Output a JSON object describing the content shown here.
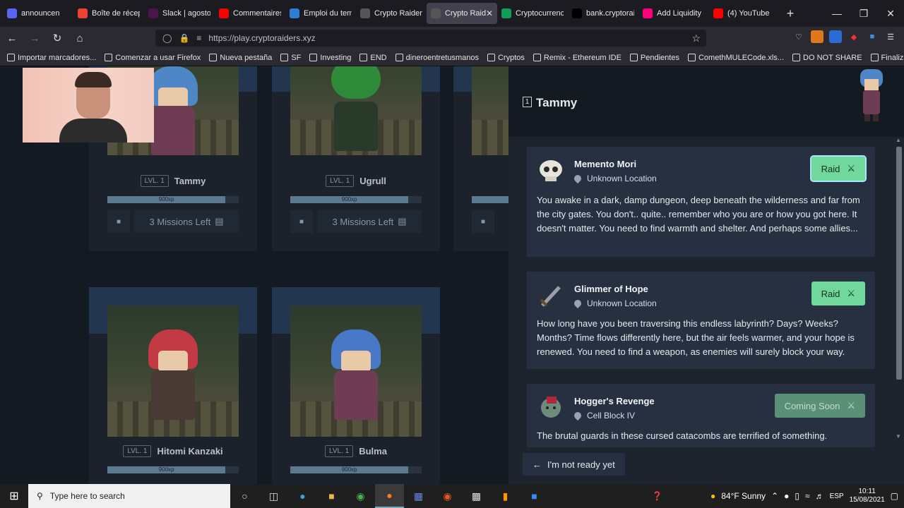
{
  "browser": {
    "tabs": [
      {
        "label": "announcen",
        "icon_color": "#5865f2",
        "icon": "discord-icon"
      },
      {
        "label": "Boîte de récep",
        "icon_color": "#ea4335",
        "icon": "gmail-icon"
      },
      {
        "label": "Slack | agosto",
        "icon_color": "#4a154b",
        "icon": "slack-icon"
      },
      {
        "label": "Commentaires",
        "icon_color": "#ff0000",
        "icon": "youtube-icon"
      },
      {
        "label": "Emploi du tem",
        "icon_color": "#2d7dd2",
        "icon": "feather-icon"
      },
      {
        "label": "Crypto Raiders",
        "icon_color": "#555555",
        "icon": "crossed-swords-icon"
      },
      {
        "label": "Crypto Raid",
        "icon_color": "#555555",
        "icon": "crossed-swords-icon",
        "active": true
      },
      {
        "label": "Cryptocurrenc",
        "icon_color": "#0f9d58",
        "icon": "sheets-icon"
      },
      {
        "label": "bank.cryptorai",
        "icon_color": "#000000",
        "icon": "triangle-icon"
      },
      {
        "label": "Add Liquidity",
        "icon_color": "#ff007a",
        "icon": "uniswap-icon"
      },
      {
        "label": "(4) YouTube",
        "icon_color": "#ff0000",
        "icon": "youtube-icon"
      }
    ],
    "new_tab": "+",
    "url": "https://play.cryptoraiders.xyz",
    "bookmarks": [
      "Importar marcadores...",
      "Comenzar a usar Firefox",
      "Nueva pestaña",
      "SF",
      "Investing",
      "END",
      "dineroentretusmanos",
      "Cryptos",
      "Remix - Ethereum IDE",
      "Pendientes",
      "ComethMULECode.xls...",
      "DO NOT SHARE",
      "Finalizar compra - De..."
    ]
  },
  "characters": [
    {
      "level": "LVL. 1",
      "name": "Tammy",
      "xp": "900xp",
      "xp_fraction": 0.9,
      "missions": "3 Missions Left",
      "hair": "#4f86c6"
    },
    {
      "level": "LVL. 1",
      "name": "Ugrull",
      "xp": "900xp",
      "xp_fraction": 0.9,
      "missions": "3 Missions Left",
      "hair": "#2f8b3a"
    },
    {
      "level": "LVL. 1",
      "name": "Hitomi Kanzaki",
      "xp": "900xp",
      "xp_fraction": 0.9,
      "hair": "#c23a44"
    },
    {
      "level": "LVL. 1",
      "name": "Bulma",
      "xp": "900xp",
      "xp_fraction": 0.9,
      "hair": "#4a78c8"
    }
  ],
  "panel": {
    "number": "1",
    "title": "Tammy",
    "missions": [
      {
        "title": "Memento Mori",
        "location": "Unknown Location",
        "button": "Raid",
        "description": "You awake in a dark, damp dungeon, deep beneath the wilderness and far from the city gates. You don't.. quite.. remember who you are or how you got here. It doesn't matter. You need to find warmth and shelter. And perhaps some allies..."
      },
      {
        "title": "Glimmer of Hope",
        "location": "Unknown Location",
        "button": "Raid",
        "description": "How long have you been traversing this endless labyrinth? Days? Weeks? Months? Time flows differently here, but the air feels warmer, and your hope is renewed. You need to find a weapon, as enemies will surely block your way."
      },
      {
        "title": "Hogger's Revenge",
        "location": "Cell Block IV",
        "button": "Coming Soon",
        "description": "The brutal guards in these cursed catacombs are terrified of something."
      }
    ],
    "back_button": "I'm not ready yet"
  },
  "taskbar": {
    "search_placeholder": "Type here to search",
    "weather": "84°F  Sunny",
    "lang": "ESP",
    "time": "10:11",
    "date": "15/08/2021"
  }
}
